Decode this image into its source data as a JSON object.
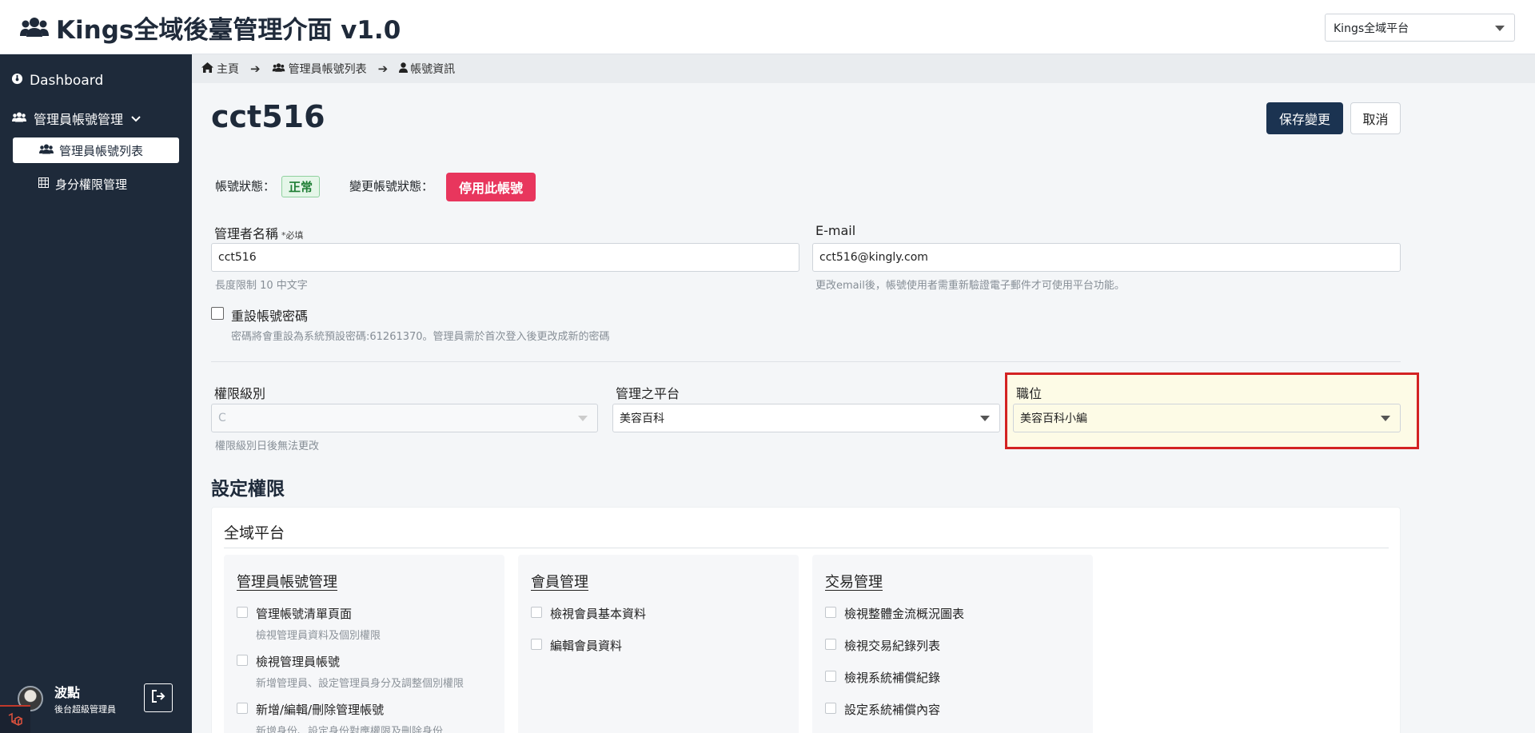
{
  "header": {
    "app_title": "Kings全域後臺管理介面 v1.0",
    "platform_selected": "Kings全域平台"
  },
  "sidebar": {
    "dashboard": "Dashboard",
    "group_label": "管理員帳號管理",
    "sub_items": [
      {
        "label": "管理員帳號列表",
        "active": true
      },
      {
        "label": "身分權限管理",
        "active": false
      }
    ],
    "user_name": "波點",
    "user_role": "後台超級管理員"
  },
  "breadcrumb": {
    "home": "主頁",
    "list": "管理員帳號列表",
    "current": "帳號資訊"
  },
  "page": {
    "title": "cct516",
    "save_label": "保存變更",
    "cancel_label": "取消"
  },
  "status": {
    "label": "帳號狀態：",
    "value": "正常",
    "change_label": "變更帳號狀態：",
    "disable_button": "停用此帳號"
  },
  "form": {
    "name_label": "管理者名稱",
    "required_mark": "*必填",
    "name_value": "cct516",
    "name_help": "長度限制 10 中文字",
    "email_label": "E-mail",
    "email_value": "cct516@kingly.com",
    "email_help": "更改email後，帳號使用者需重新驗證電子郵件才可使用平台功能。",
    "reset_label": "重設帳號密碼",
    "reset_help": "密碼將會重設為系統預設密碼:61261370。管理員需於首次登入後更改成新的密碼",
    "level_label": "權限級別",
    "level_value": "C",
    "level_help": "權限級別日後無法更改",
    "platform_label": "管理之平台",
    "platform_value": "美容百科",
    "position_label": "職位",
    "position_value": "美容百科小編"
  },
  "permissions": {
    "section_title": "設定權限",
    "card_title": "全域平台",
    "columns": [
      {
        "title": "管理員帳號管理",
        "items": [
          {
            "label": "管理帳號清單頁面",
            "desc": "檢視管理員資料及個別權限"
          },
          {
            "label": "檢視管理員帳號",
            "desc": "新增管理員、設定管理員身分及調整個別權限"
          },
          {
            "label": "新增/編輯/刪除管理帳號",
            "desc": "新增身份、設定身份對應權限及刪除身份"
          }
        ]
      },
      {
        "title": "會員管理",
        "items": [
          {
            "label": "檢視會員基本資料",
            "desc": ""
          },
          {
            "label": "編輯會員資料",
            "desc": ""
          }
        ]
      },
      {
        "title": "交易管理",
        "items": [
          {
            "label": "檢視整體金流概況圖表",
            "desc": ""
          },
          {
            "label": "檢視交易紀錄列表",
            "desc": ""
          },
          {
            "label": "檢視系統補償紀錄",
            "desc": ""
          },
          {
            "label": "設定系統補償內容",
            "desc": ""
          }
        ]
      }
    ]
  },
  "colors": {
    "sidebar_bg": "#1e2a3a",
    "primary": "#1b3351",
    "danger": "#e8365d",
    "success": "#1e7e34",
    "highlight": "#d32222"
  }
}
